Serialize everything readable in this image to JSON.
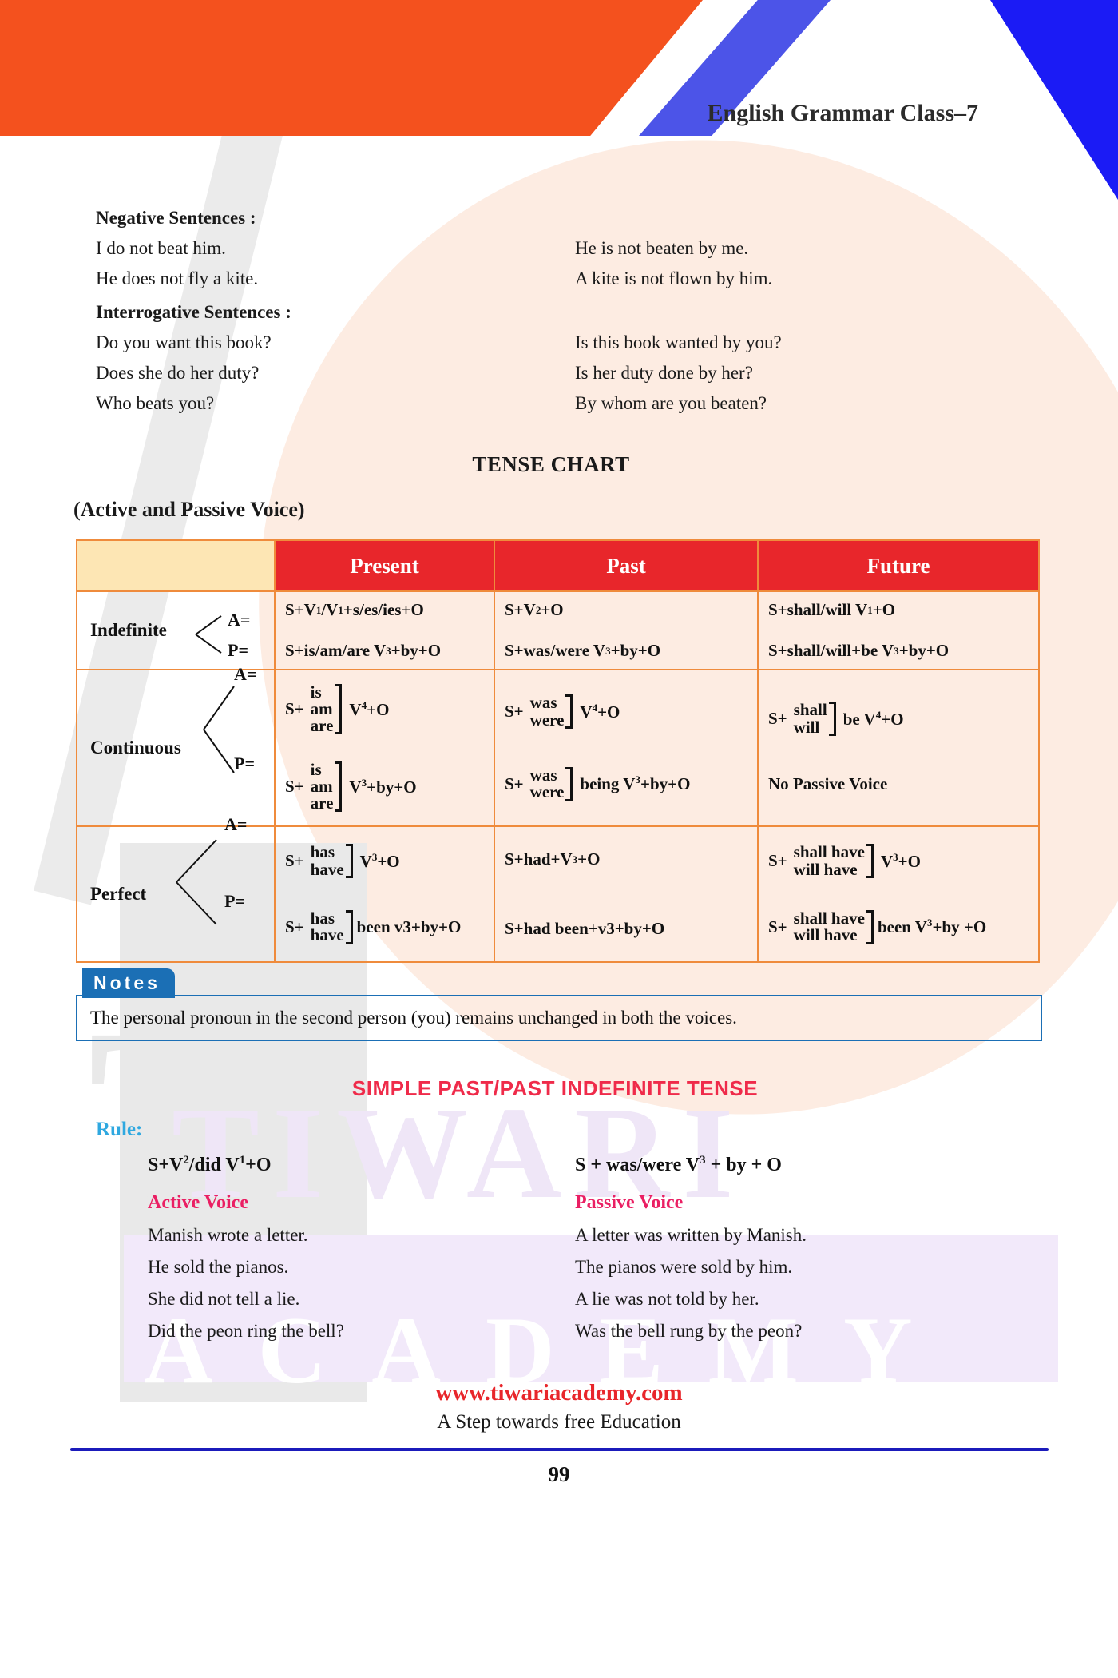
{
  "header": {
    "title": "English Grammar Class–7",
    "orange_color": "#f4511e",
    "blue_color": "#4c54e8",
    "corner_color": "#1b1bf5"
  },
  "negative": {
    "heading": "Negative Sentences :",
    "pairs": [
      {
        "active": "I do not beat him.",
        "passive": "He is not beaten by me."
      },
      {
        "active": "He does not fly a kite.",
        "passive": "A kite is not flown by him."
      }
    ]
  },
  "interrogative": {
    "heading": "Interrogative Sentences :",
    "pairs": [
      {
        "active": "Do you want this book?",
        "passive": "Is this book wanted by you?"
      },
      {
        "active": "Does she do her duty?",
        "passive": "Is her duty done by her?"
      },
      {
        "active": "Who beats you?",
        "passive": "By whom are you beaten?"
      }
    ]
  },
  "tense_chart": {
    "title": "TENSE CHART",
    "subtitle": "(Active and Passive Voice)",
    "header_bg": "#e8262b",
    "corner_bg": "#fde6b4",
    "border_color": "#ef8b3c",
    "columns": [
      "",
      "Present",
      "Past",
      "Future"
    ],
    "rows": [
      {
        "label": "Indefinite",
        "active_mark": "A=",
        "passive_mark": "P=",
        "present": {
          "active_pre": "S+V",
          "active_sup1": "1",
          "active_mid": "/V",
          "active_sup2": "1",
          "active_post": "+s/es/ies+O",
          "passive_pre": "S+is/am/are V",
          "passive_sup": "3",
          "passive_post": "+by+O"
        },
        "past": {
          "active_pre": "S+V",
          "active_sup": "2",
          "active_post": "+O",
          "passive_pre": "S+was/were V",
          "passive_sup": "3",
          "passive_post": "+by+O"
        },
        "future": {
          "active_pre": "S+shall/will V",
          "active_sup": "1",
          "active_post": "+O",
          "passive_pre": "S+shall/will+be V",
          "passive_sup": "3",
          "passive_post": "+by+O"
        }
      },
      {
        "label": "Continuous",
        "active_mark": "A=",
        "passive_mark": "P=",
        "present": {
          "active_prefix": "S+",
          "active_stack": [
            "is",
            "am",
            "are"
          ],
          "active_suffix": "V",
          "active_sup": "4",
          "active_tail": "+O",
          "passive_prefix": "S+",
          "passive_stack": [
            "is",
            "am",
            "are"
          ],
          "passive_suffix": "V",
          "passive_sup": "3",
          "passive_tail": "+by+O"
        },
        "past": {
          "active_prefix": "S+",
          "active_stack": [
            "was",
            "were"
          ],
          "active_suffix": "V",
          "active_sup": "4",
          "active_tail": "+O",
          "passive_prefix": "S+",
          "passive_stack": [
            "was",
            "were"
          ],
          "passive_suffix": "being V",
          "passive_sup": "3",
          "passive_tail": "+by+O"
        },
        "future": {
          "active_prefix": "S+",
          "active_stack": [
            "shall",
            "will"
          ],
          "active_suffix": "be V",
          "active_sup": "4",
          "active_tail": "+O",
          "passive_text": "No Passive Voice"
        }
      },
      {
        "label": "Perfect",
        "active_mark": "A=",
        "passive_mark": "P=",
        "present": {
          "active_prefix": "S+",
          "active_stack": [
            "has",
            "have"
          ],
          "active_suffix": "V",
          "active_sup": "3",
          "active_tail": "+O",
          "passive_prefix": "S+",
          "passive_stack": [
            "has",
            "have"
          ],
          "passive_suffix": "been v3+by+O",
          "passive_sup": "",
          "passive_tail": ""
        },
        "past": {
          "active_pre": "S+had+V",
          "active_sup": "3",
          "active_post": "+O",
          "passive_plain": "S+had been+v3+by+O"
        },
        "future": {
          "active_prefix": "S+",
          "active_stack": [
            "shall have",
            "will have"
          ],
          "active_suffix": "V",
          "active_sup": "3",
          "active_tail": "+O",
          "passive_prefix": "S+",
          "passive_stack": [
            "shall have",
            "will have"
          ],
          "passive_suffix": "been V",
          "passive_sup": "3",
          "passive_tail": "+by +O"
        }
      }
    ]
  },
  "notes": {
    "tab_label": "Notes",
    "text": "The personal pronoun in the second person (you) remains unchanged in both the  voices.",
    "accent_color": "#1b6fb5"
  },
  "simple_past": {
    "title": "SIMPLE PAST/PAST INDEFINITE TENSE",
    "title_color": "#ef2b4a",
    "rule_label": "Rule:",
    "rule_label_color": "#2fa8e0",
    "rule_active_pre": "S+V",
    "rule_active_sup": "2",
    "rule_active_mid": "/did V",
    "rule_active_sup2": "1",
    "rule_active_post": "+O",
    "rule_passive_pre": "S + was/were V",
    "rule_passive_sup": "3",
    "rule_passive_post": " + by + O",
    "active_heading": "Active Voice",
    "passive_heading": "Passive Voice",
    "heading_color": "#ea1f63",
    "examples": [
      {
        "active": "Manish wrote a letter.",
        "passive": "A letter was written by Manish."
      },
      {
        "active": "He sold the pianos.",
        "passive": "The pianos were sold by him."
      },
      {
        "active": "She did not tell a lie.",
        "passive": "A lie was not told by her."
      },
      {
        "active": "Did the peon ring the bell?",
        "passive": "Was the bell rung by the peon?"
      }
    ]
  },
  "footer": {
    "url": "www.tiwariacademy.com",
    "url_color": "#e8262b",
    "tagline": "A Step towards free Education",
    "rule_color": "#1b1bbb",
    "page_number": "99"
  },
  "watermark": {
    "brand_top": "TIWARI",
    "brand_bottom": "ACADEMY",
    "initial": "T"
  }
}
